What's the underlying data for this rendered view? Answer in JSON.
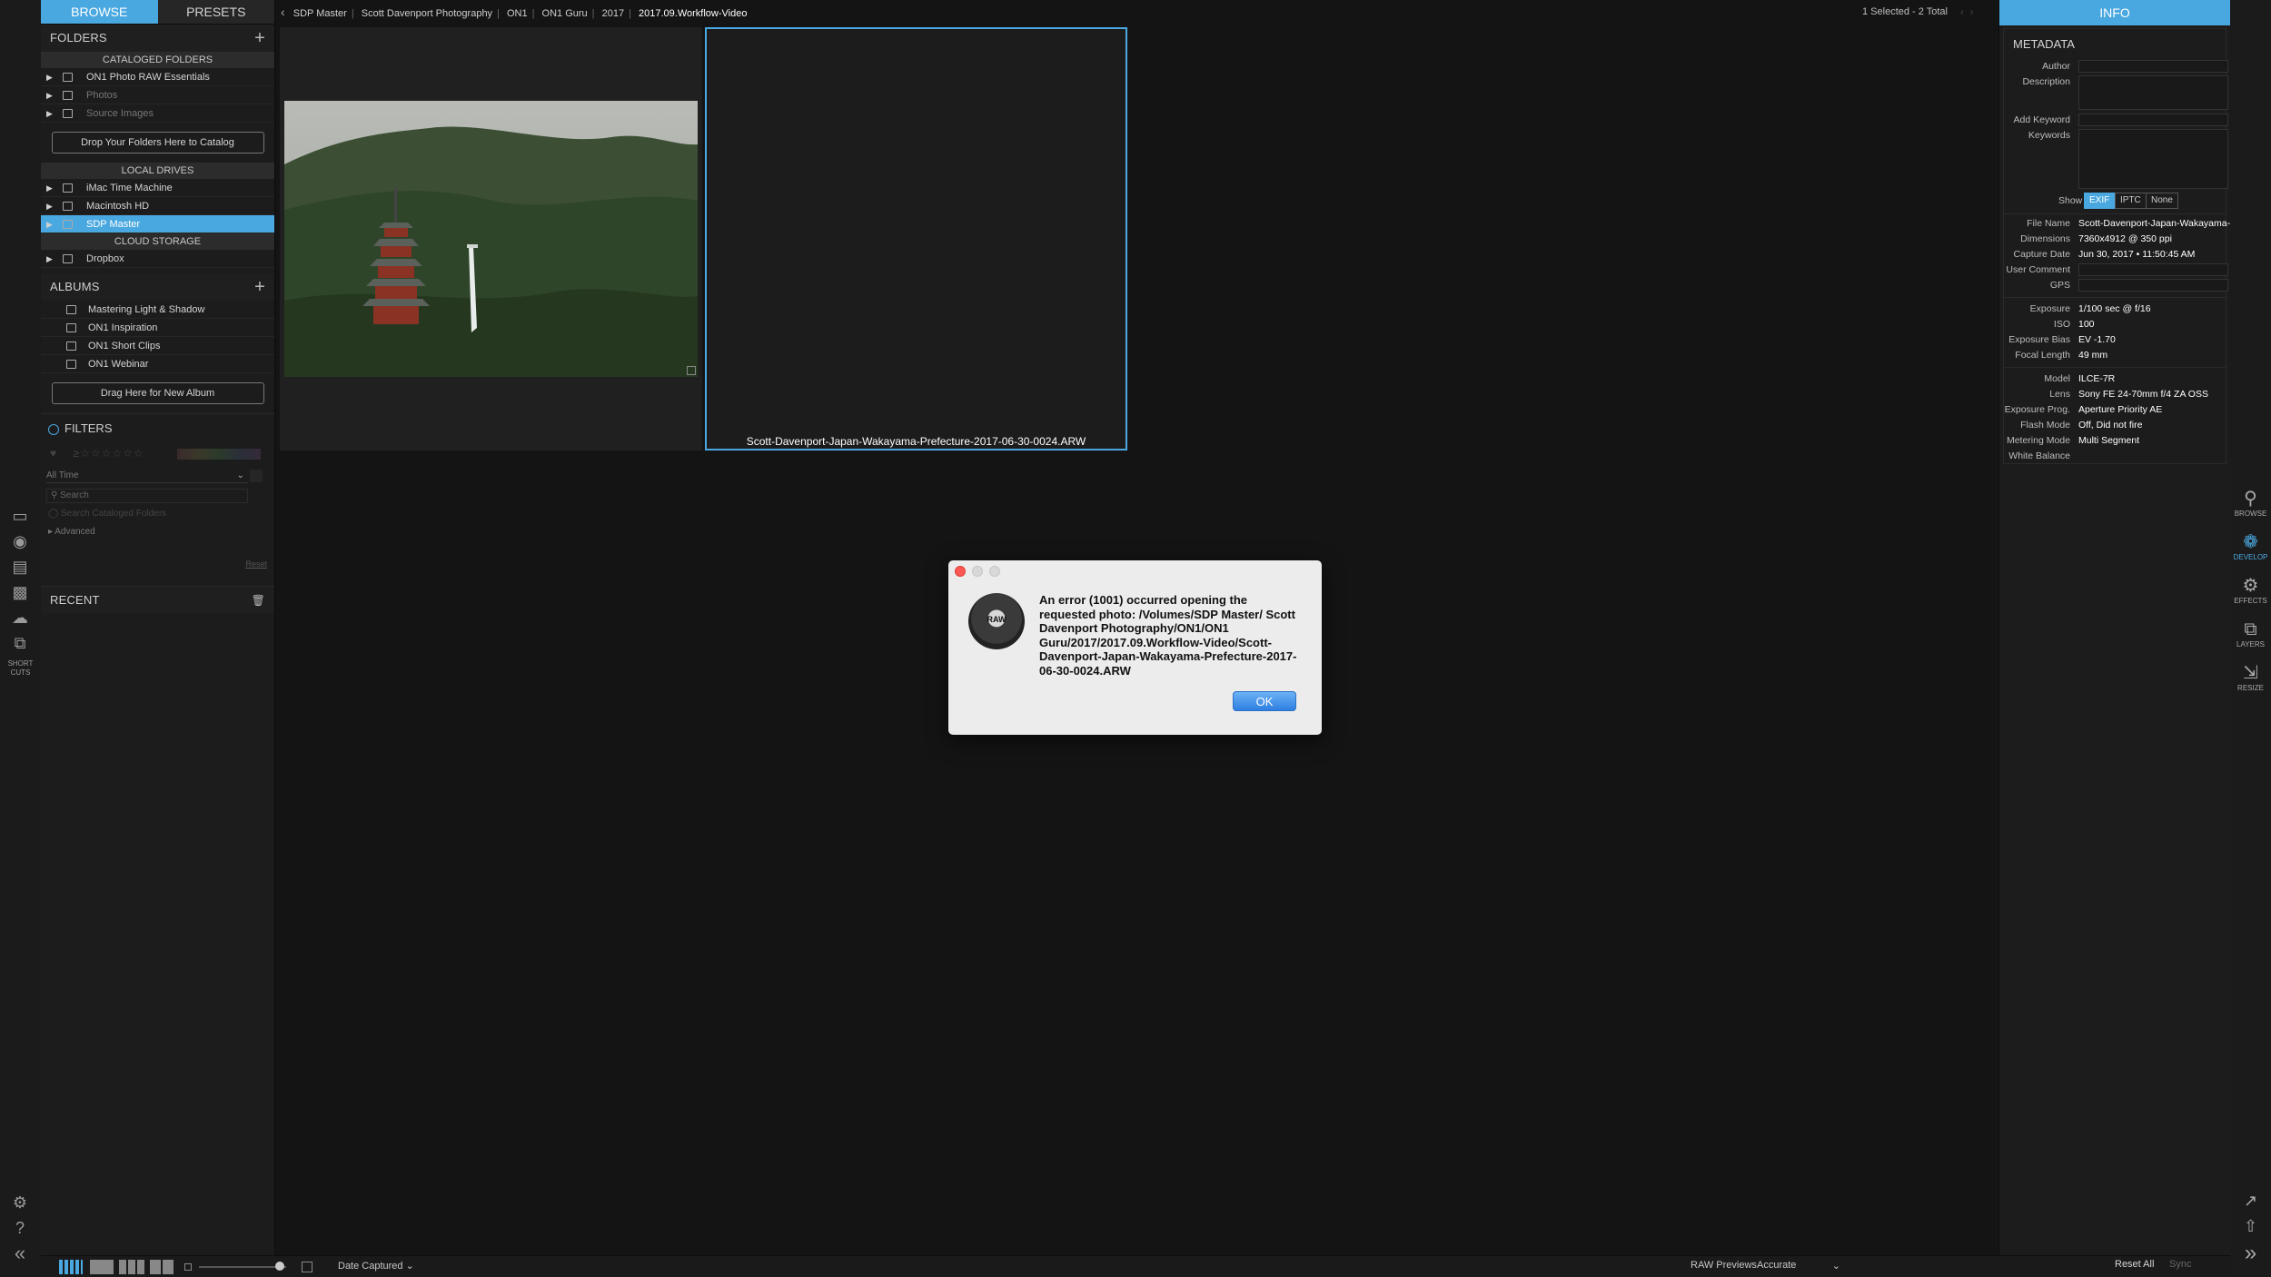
{
  "left_panel": {
    "tabs": [
      "BROWSE",
      "PRESETS"
    ],
    "folders": {
      "title": "FOLDERS",
      "cataloged_header": "CATALOGED FOLDERS",
      "cataloged": [
        {
          "label": "ON1 Photo RAW Essentials",
          "dim": false
        },
        {
          "label": "Photos",
          "dim": true
        },
        {
          "label": "Source Images",
          "dim": true
        }
      ],
      "drop_button": "Drop Your Folders Here to Catalog",
      "local_header": "LOCAL DRIVES",
      "local": [
        {
          "label": "iMac Time Machine"
        },
        {
          "label": "Macintosh HD"
        },
        {
          "label": "SDP Master",
          "selected": true
        }
      ],
      "cloud_header": "CLOUD STORAGE",
      "cloud": [
        {
          "label": "Dropbox"
        }
      ]
    },
    "albums": {
      "title": "ALBUMS",
      "items": [
        "Mastering Light & Shadow",
        "ON1 Inspiration",
        "ON1 Short Clips",
        "ON1 Webinar"
      ],
      "drag_button": "Drag Here for New Album"
    },
    "filters": {
      "title": "FILTERS",
      "time": "All Time",
      "search_placeholder": "Search",
      "search_cataloged": "Search Cataloged Folders",
      "advanced": "Advanced",
      "reset": "Reset"
    },
    "recent": {
      "title": "RECENT"
    },
    "toolbar_shortcuts_label": "SHORT\nCUTS"
  },
  "breadcrumb": [
    "SDP Master",
    "Scott Davenport Photography",
    "ON1",
    "ON1 Guru",
    "2017",
    "2017.09.Workflow-Video"
  ],
  "selection_info": "1 Selected - 2 Total",
  "grid": {
    "selected_filename": "Scott-Davenport-Japan-Wakayama-Prefecture-2017-06-30-0024.ARW"
  },
  "right_panel": {
    "tab": "INFO",
    "metadata_title": "METADATA",
    "fields": [
      "Author",
      "Description",
      "Add Keyword",
      "Keywords"
    ],
    "show_label": "Show",
    "show_options": [
      "EXIF",
      "IPTC",
      "None"
    ],
    "show_selected": "EXIF",
    "file_info": [
      {
        "k": "File Name",
        "v": "Scott-Davenport-Japan-Wakayama-"
      },
      {
        "k": "Dimensions",
        "v": "7360x4912 @ 350 ppi"
      },
      {
        "k": "Capture Date",
        "v": "Jun 30, 2017 • 11:50:45 AM"
      },
      {
        "k": "User Comment",
        "v": ""
      },
      {
        "k": "GPS",
        "v": ""
      }
    ],
    "exposure_info": [
      {
        "k": "Exposure",
        "v": "1/100 sec @ f/16"
      },
      {
        "k": "ISO",
        "v": "100"
      },
      {
        "k": "Exposure Bias",
        "v": "EV -1.70"
      },
      {
        "k": "Focal Length",
        "v": "49 mm"
      }
    ],
    "camera_info": [
      {
        "k": "Model",
        "v": "ILCE-7R"
      },
      {
        "k": "Lens",
        "v": "Sony FE 24-70mm f/4 ZA OSS"
      },
      {
        "k": "Exposure Prog.",
        "v": "Aperture Priority AE"
      },
      {
        "k": "Flash Mode",
        "v": "Off, Did not fire"
      },
      {
        "k": "Metering Mode",
        "v": "Multi Segment"
      },
      {
        "k": "White Balance",
        "v": ""
      }
    ]
  },
  "modules": [
    "BROWSE",
    "DEVELOP",
    "EFFECTS",
    "LAYERS",
    "RESIZE"
  ],
  "active_module": "DEVELOP",
  "bottom_bar": {
    "sort": "Date Captured",
    "raw_previews_label": "RAW Previews",
    "raw_previews_value": "Accurate",
    "reset_all": "Reset All",
    "sync": "Sync"
  },
  "dialog": {
    "message": "An error (1001) occurred opening the requested photo: /Volumes/SDP Master/ Scott Davenport Photography/ON1/ON1 Guru/2017/2017.09.Workflow-Video/Scott-Davenport-Japan-Wakayama-Prefecture-2017-06-30-0024.ARW",
    "ok": "OK",
    "icon_text": "RAW"
  },
  "colors": {
    "accent": "#4aa8e0",
    "panel": "#1c1c1c",
    "background": "#141414"
  }
}
